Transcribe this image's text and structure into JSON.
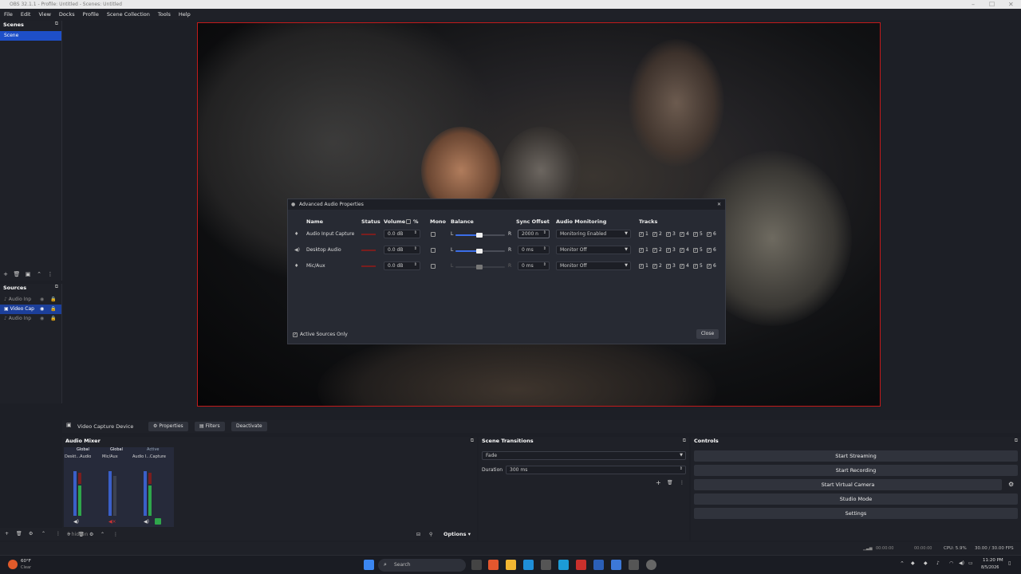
{
  "window": {
    "title": "OBS 32.1.1 - Profile: Untitled - Scenes: Untitled"
  },
  "menu": [
    "File",
    "Edit",
    "View",
    "Docks",
    "Profile",
    "Scene Collection",
    "Tools",
    "Help"
  ],
  "scenes": {
    "title": "Scenes",
    "items": [
      "Scene"
    ]
  },
  "sources": {
    "title": "Sources",
    "items": [
      "Audio Inp",
      "Video Cap",
      "Audio Inp"
    ]
  },
  "dialog": {
    "title": "Advanced Audio Properties",
    "headers": {
      "name": "Name",
      "status": "Status",
      "volume": "Volume",
      "percent": "%",
      "mono": "Mono",
      "balance": "Balance",
      "sync": "Sync Offset",
      "monitoring": "Audio Monitoring",
      "tracks": "Tracks"
    },
    "rows": [
      {
        "name": "Audio Input Capture",
        "volume": "0.0 dB",
        "sync": "2000 n",
        "monitoring": "Monitoring Enabled",
        "balance": 0.5
      },
      {
        "name": "Desktop Audio",
        "volume": "0.0 dB",
        "sync": "0 ms",
        "monitoring": "Monitor Off",
        "balance": 0.5
      },
      {
        "name": "Mic/Aux",
        "volume": "0.0 dB",
        "sync": "0 ms",
        "monitoring": "Monitor Off",
        "balance": 0.5
      }
    ],
    "balance_l": "L",
    "balance_r": "R",
    "track_labels": [
      "1",
      "2",
      "3",
      "4",
      "5",
      "6"
    ],
    "active_only": "Active Sources Only",
    "close": "Close"
  },
  "source_toolbar": {
    "source": "Video Capture Device",
    "properties": "Properties",
    "filters": "Filters",
    "deactivate": "Deactivate"
  },
  "mixer": {
    "title": "Audio Mixer",
    "channels": [
      {
        "tag": "Global",
        "name": "Deskt...Audio"
      },
      {
        "tag": "Global",
        "name": "Mic/Aux"
      },
      {
        "tag": "Active",
        "name": "Audio I...Capture"
      }
    ],
    "hidden": "0 hidden",
    "options": "Options"
  },
  "transitions": {
    "title": "Scene Transitions",
    "type": "Fade",
    "duration_label": "Duration",
    "duration": "300 ms"
  },
  "controls": {
    "title": "Controls",
    "buttons": [
      "Start Streaming",
      "Start Recording",
      "Start Virtual Camera",
      "Studio Mode",
      "Settings"
    ]
  },
  "status": {
    "time1": "00:00:00",
    "time2": "00:00:00",
    "cpu": "CPU: 5.9%",
    "fps": "30.00 / 30.00 FPS"
  },
  "taskbar": {
    "weather_temp": "60°F",
    "weather_desc": "Clear",
    "search": "Search",
    "clock_time": "11:20 PM",
    "clock_date": "8/5/2026"
  }
}
